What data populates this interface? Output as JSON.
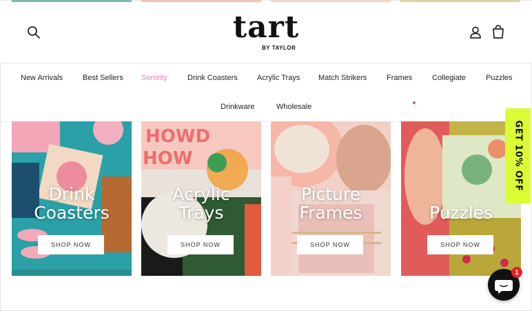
{
  "header": {
    "logo_main": "tart",
    "logo_sub": "BY TAYLOR",
    "icons": [
      "search-icon",
      "account-icon",
      "cart-icon"
    ]
  },
  "nav": {
    "items": [
      {
        "label": "New Arrivals"
      },
      {
        "label": "Best Sellers"
      },
      {
        "label": "Sorority",
        "active": true
      },
      {
        "label": "Drink Coasters"
      },
      {
        "label": "Acrylic Trays"
      },
      {
        "label": "Match Strikers"
      },
      {
        "label": "Frames"
      },
      {
        "label": "Collegiate"
      },
      {
        "label": "Puzzles"
      },
      {
        "label": "Drinkware"
      },
      {
        "label": "Wholesale"
      }
    ],
    "active_color": "#e580b4"
  },
  "tiles": [
    {
      "title_line1": "Drink",
      "title_line2": "Coasters",
      "button": "SHOP NOW",
      "bg": "#2ea3a8"
    },
    {
      "title_line1": "Acrylic",
      "title_line2": "Trays",
      "button": "SHOP NOW",
      "bg": "#f0a39a"
    },
    {
      "title_line1": "Picture",
      "title_line2": "Frames",
      "button": "SHOP NOW",
      "bg": "#f2c6c0"
    },
    {
      "title_line1": "",
      "title_line2": "Puzzles",
      "button": "SHOP NOW",
      "bg": "#c9b84a"
    }
  ],
  "promo": {
    "label": "GET 10% OFF",
    "color": "#dbfb34"
  },
  "chat": {
    "badge": "1",
    "icon": "chat-icon"
  }
}
